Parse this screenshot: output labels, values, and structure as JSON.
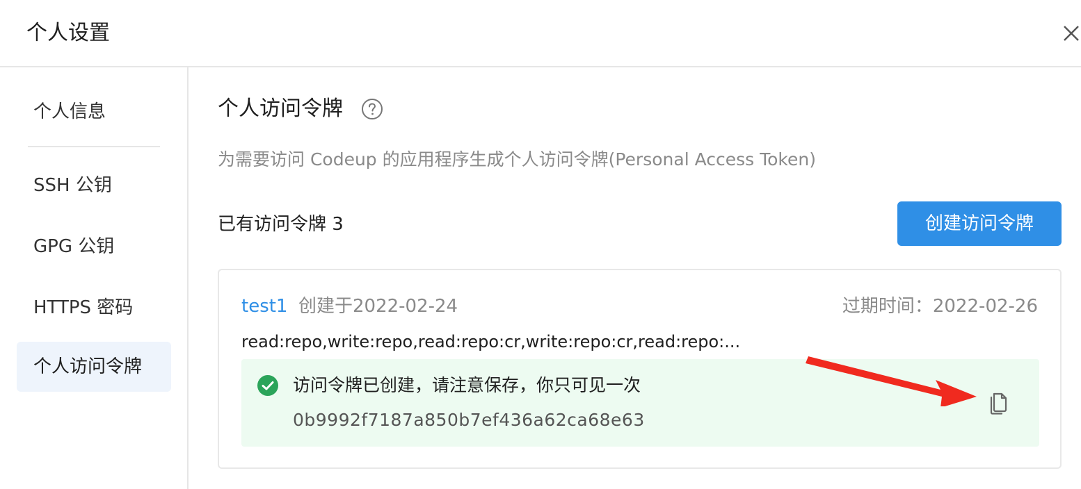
{
  "dialog": {
    "title": "个人设置",
    "close_icon": "close-icon"
  },
  "sidebar": {
    "items": [
      {
        "label": "个人信息",
        "active": false
      },
      {
        "label": "SSH 公钥",
        "active": false
      },
      {
        "label": "GPG 公钥",
        "active": false
      },
      {
        "label": "HTTPS 密码",
        "active": false
      },
      {
        "label": "个人访问令牌",
        "active": true
      }
    ]
  },
  "main": {
    "title": "个人访问令牌",
    "help_icon": "question-circle-icon",
    "description": "为需要访问 Codeup 的应用程序生成个人访问令牌(Personal Access Token)",
    "count_label": "已有访问令牌 3",
    "create_button": "创建访问令牌"
  },
  "token": {
    "name": "test1",
    "created": "创建于2022-02-24",
    "expire": "过期时间：2022-02-26",
    "scopes": "read:repo,write:repo,read:repo:cr,write:repo:cr,read:repo:...",
    "alert_message": "访问令牌已创建，请注意保存，你只可见一次",
    "value": "0b9992f7187a850b7ef436a62ca68e63",
    "success_icon": "check-circle-icon",
    "copy_icon": "copy-icon"
  },
  "colors": {
    "accent": "#2f8fe6",
    "success": "#2ba45a",
    "alert_bg": "#edfbf1",
    "annotation_arrow": "#f02a1f"
  }
}
